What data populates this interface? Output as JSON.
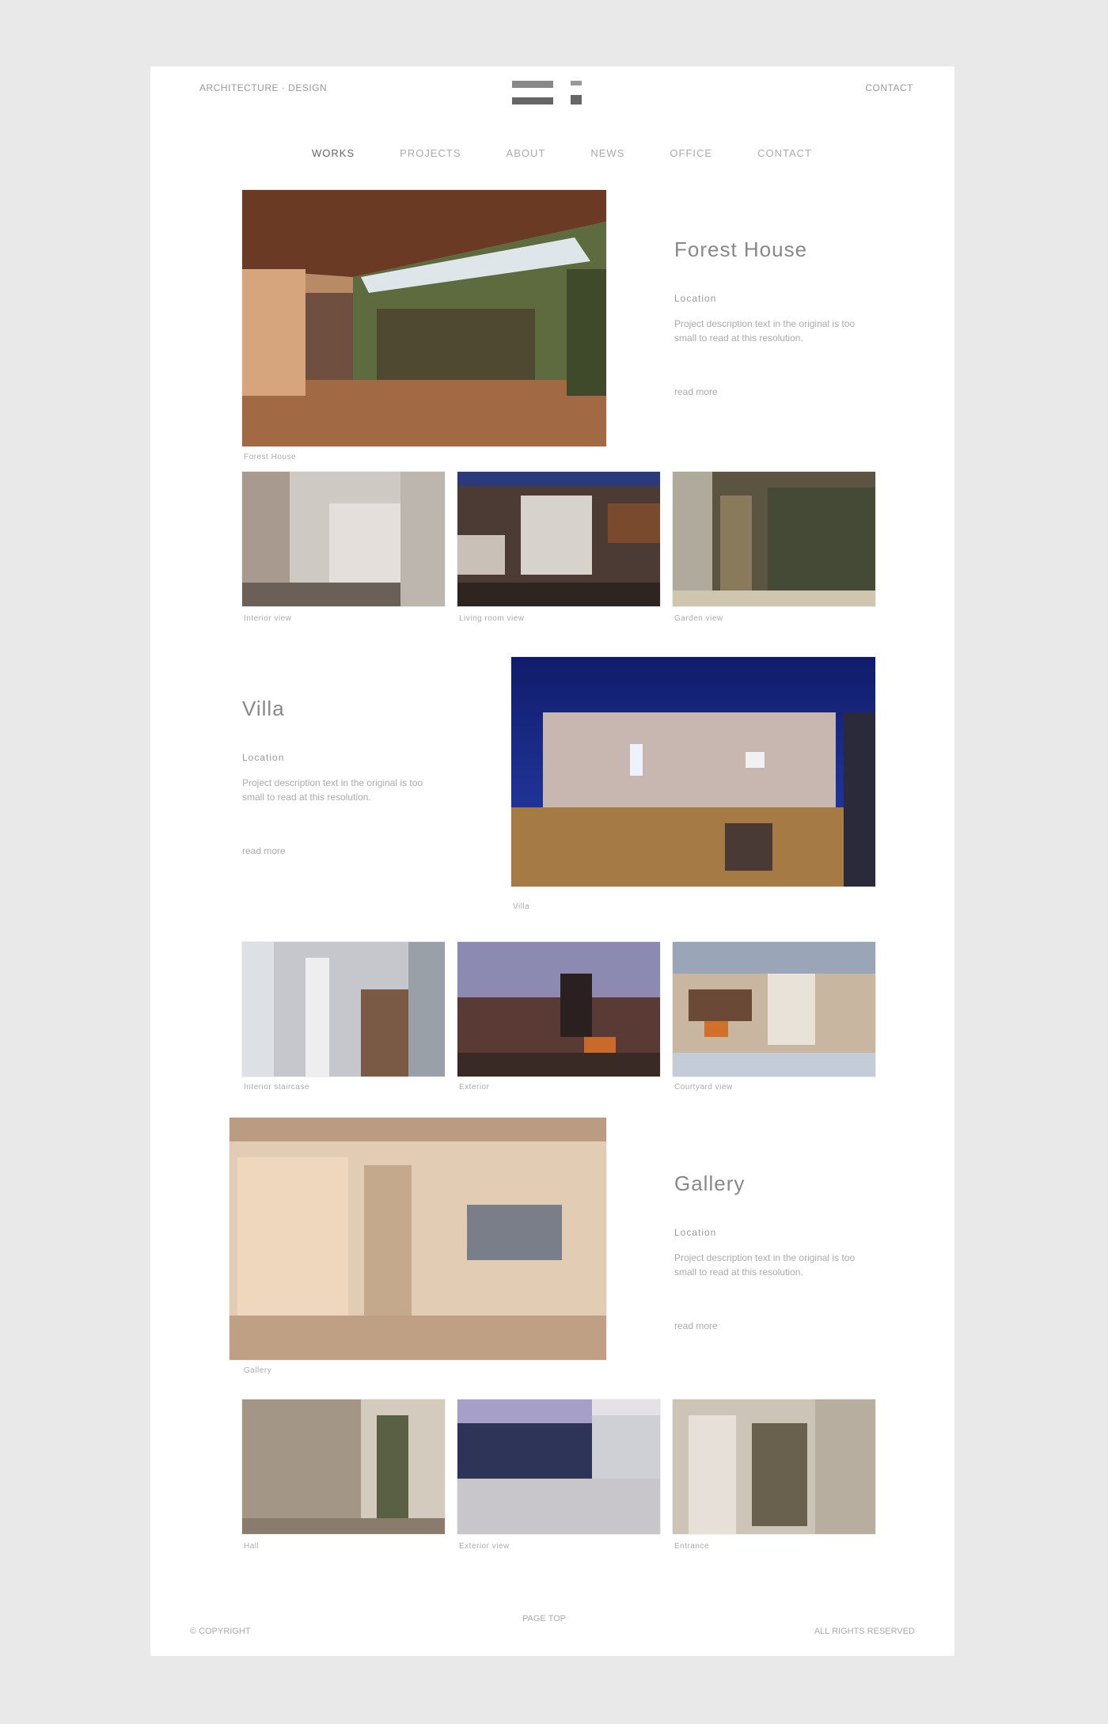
{
  "header": {
    "left_text": "ARCHITECTURE · DESIGN",
    "right_text": "CONTACT",
    "nav": [
      "WORKS",
      "PROJECTS",
      "ABOUT",
      "NEWS",
      "OFFICE",
      "CONTACT"
    ]
  },
  "projects": [
    {
      "title": "Forest House",
      "location": "Location",
      "description": "Project description text in the original is too small to read at this resolution.",
      "more": "read more",
      "hero_caption": "Forest House",
      "thumb_captions": [
        "Interior view",
        "Living room view",
        "Garden view"
      ]
    },
    {
      "title": "Villa",
      "location": "Location",
      "description": "Project description text in the original is too small to read at this resolution.",
      "more": "read more",
      "hero_caption": "Villa",
      "thumb_captions": [
        "Interior staircase",
        "Exterior",
        "Courtyard view"
      ]
    },
    {
      "title": "Gallery",
      "location": "Location",
      "description": "Project description text in the original is too small to read at this resolution.",
      "more": "read more",
      "hero_caption": "Gallery",
      "thumb_captions": [
        "Hall",
        "Exterior view",
        "Entrance"
      ]
    }
  ],
  "footer": {
    "left": "© COPYRIGHT",
    "center": "PAGE TOP",
    "right": "ALL RIGHTS RESERVED"
  },
  "icons": [
    "logo-mark-icon"
  ]
}
